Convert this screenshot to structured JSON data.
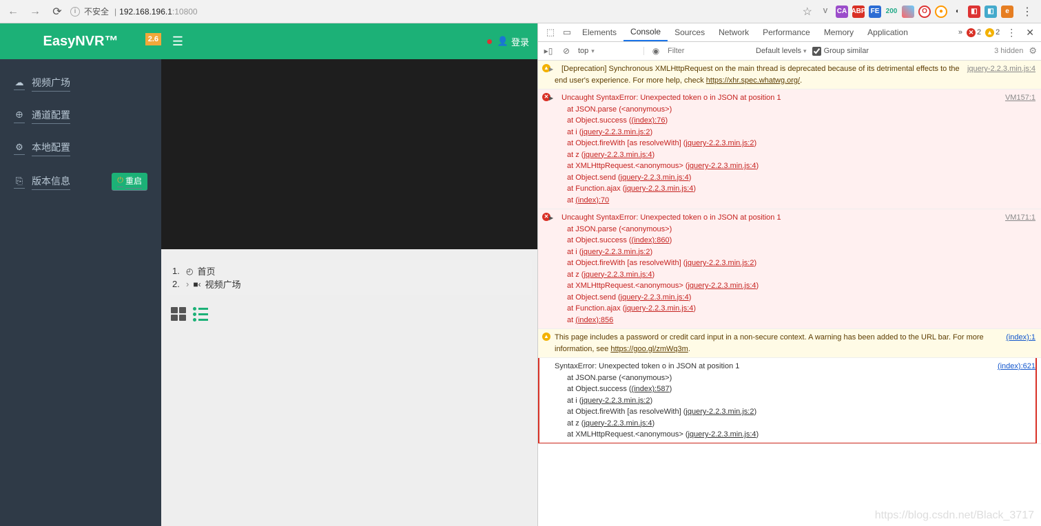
{
  "browser": {
    "unsafe_label": "不安全",
    "host": "192.168.196.1",
    "port": ":10800"
  },
  "app": {
    "logo": "EasyNVR™",
    "version": "2.6",
    "login": "登录"
  },
  "sidebar": {
    "items": [
      {
        "label": "视频广场"
      },
      {
        "label": "通道配置"
      },
      {
        "label": "本地配置"
      },
      {
        "label": "版本信息"
      }
    ],
    "restart": "重启"
  },
  "breadcrumb": {
    "row1_num": "1.",
    "row1_label": "首页",
    "row2_num": "2.",
    "row2_label": "视频广场"
  },
  "devtools": {
    "tabs": {
      "elements": "Elements",
      "console": "Console",
      "sources": "Sources",
      "network": "Network",
      "performance": "Performance",
      "memory": "Memory",
      "application": "Application"
    },
    "errcount": "2",
    "warncount": "2",
    "context": "top",
    "filter_placeholder": "Filter",
    "levels": "Default levels",
    "group": "Group similar",
    "hidden": "3 hidden"
  },
  "console": {
    "warn1_text": "[Deprecation] Synchronous XMLHttpRequest on the main thread is deprecated because of its detrimental effects to the end user's experience. For more help, check ",
    "warn1_link": "https://xhr.spec.whatwg.org/",
    "warn1_src": "jquery-2.2.3.min.js:4",
    "err_head": "Uncaught SyntaxError: Unexpected token o in JSON at position 1",
    "err1_src": "VM157:1",
    "t_parse": "at JSON.parse (<anonymous>)",
    "t_succ1": "at Object.success (",
    "t_succ1_l": "(index):76",
    "t_i": "at i (",
    "t_jq2": "jquery-2.2.3.min.js:2",
    "t_fire": "at Object.fireWith [as resolveWith] (",
    "t_z": "at z (",
    "t_jq4": "jquery-2.2.3.min.js:4",
    "t_xhr": "at XMLHttpRequest.<anonymous> (",
    "t_send": "at Object.send (",
    "t_ajax": "at Function.ajax (",
    "t_at": "at ",
    "t_idx70": "(index):70",
    "err2_src": "VM171:1",
    "t_succ2_l": "(index):860",
    "t_idx856": "(index):856",
    "warn2_text": "This page includes a password or credit card input in a non-secure context. A warning has been added to the URL bar. For more information, see ",
    "warn2_link": "https://goo.gl/zmWq3m",
    "warn2_src": "(index):1",
    "plain_head": "SyntaxError: Unexpected token o in JSON at position 1",
    "plain_src": "(index):621",
    "t_succ3_l": "(index):587"
  },
  "watermark": "https://blog.csdn.net/Black_3717"
}
